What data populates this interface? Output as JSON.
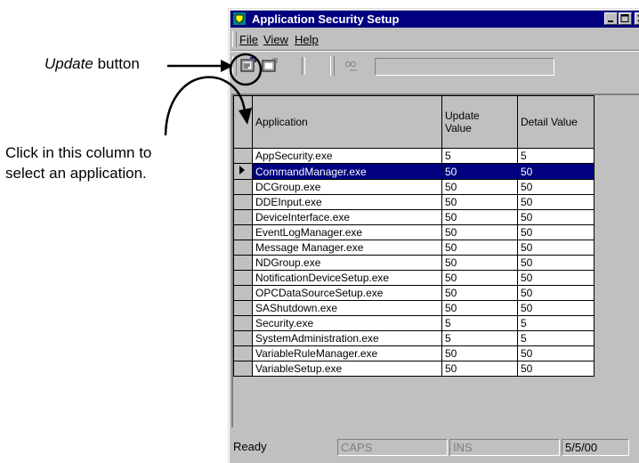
{
  "annotations": {
    "update_button_italic": "Update",
    "update_button_rest": "button",
    "select_column_line1": "Click in this column to",
    "select_column_line2": "select an application."
  },
  "window": {
    "title": "Application Security Setup",
    "app_icon": "shield-app-icon",
    "controls": [
      "minimize-icon",
      "maximize-icon",
      "close-icon"
    ]
  },
  "menu": {
    "file": "File",
    "view": "View",
    "help": "Help"
  },
  "toolbar": {
    "update_icon": "update-icon",
    "detail_icon": "detail-icon",
    "find_icon": "binoculars-icon",
    "combo_value": ""
  },
  "grid": {
    "columns": [
      "Application",
      "Update Value",
      "Detail Value"
    ],
    "column_header_update_line1": "Update",
    "column_header_update_line2": "Value",
    "selected_row_index": 1,
    "rows": [
      {
        "app": "AppSecurity.exe",
        "update": "5",
        "detail": "5"
      },
      {
        "app": "CommandManager.exe",
        "update": "50",
        "detail": "50"
      },
      {
        "app": "DCGroup.exe",
        "update": "50",
        "detail": "50"
      },
      {
        "app": "DDEInput.exe",
        "update": "50",
        "detail": "50"
      },
      {
        "app": "DeviceInterface.exe",
        "update": "50",
        "detail": "50"
      },
      {
        "app": "EventLogManager.exe",
        "update": "50",
        "detail": "50"
      },
      {
        "app": "Message Manager.exe",
        "update": "50",
        "detail": "50"
      },
      {
        "app": "NDGroup.exe",
        "update": "50",
        "detail": "50"
      },
      {
        "app": "NotificationDeviceSetup.exe",
        "update": "50",
        "detail": "50"
      },
      {
        "app": "OPCDataSourceSetup.exe",
        "update": "50",
        "detail": "50"
      },
      {
        "app": "SAShutdown.exe",
        "update": "50",
        "detail": "50"
      },
      {
        "app": "Security.exe",
        "update": "5",
        "detail": "5"
      },
      {
        "app": "SystemAdministration.exe",
        "update": "5",
        "detail": "5"
      },
      {
        "app": "VariableRuleManager.exe",
        "update": "50",
        "detail": "50"
      },
      {
        "app": "VariableSetup.exe",
        "update": "50",
        "detail": "50"
      }
    ]
  },
  "status": {
    "state": "Ready",
    "caps": "CAPS",
    "ins": "INS",
    "date": "5/5/00"
  }
}
